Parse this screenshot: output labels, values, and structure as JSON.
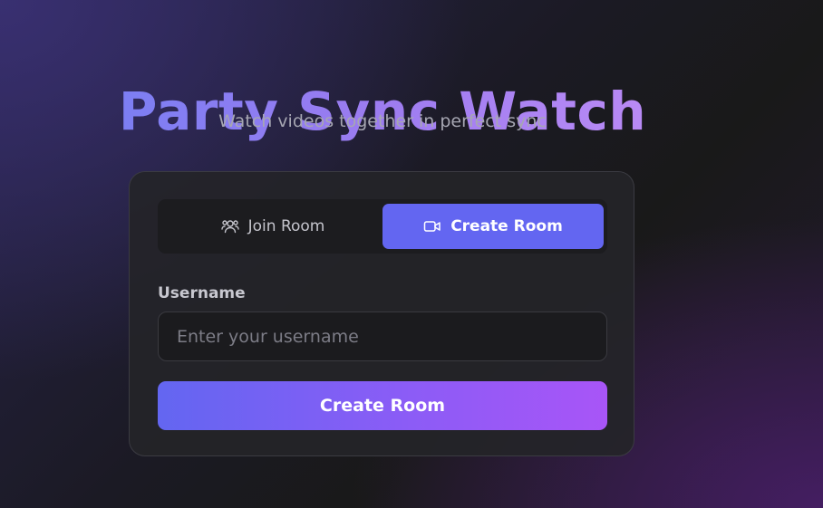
{
  "header": {
    "title": "Party Sync Watch",
    "subtitle": "Watch videos together in perfect sync"
  },
  "tabs": [
    {
      "label": "Join Room",
      "icon": "users-icon",
      "active": false
    },
    {
      "label": "Create Room",
      "icon": "video-camera-icon",
      "active": true
    }
  ],
  "form": {
    "username_label": "Username",
    "username_placeholder": "Enter your username",
    "username_value": "",
    "submit_label": "Create Room"
  },
  "colors": {
    "accent": "#6366f1",
    "gradient_end": "#a855f7",
    "title_gradient_start": "#7c7ef3",
    "title_gradient_end": "#b98af5"
  }
}
